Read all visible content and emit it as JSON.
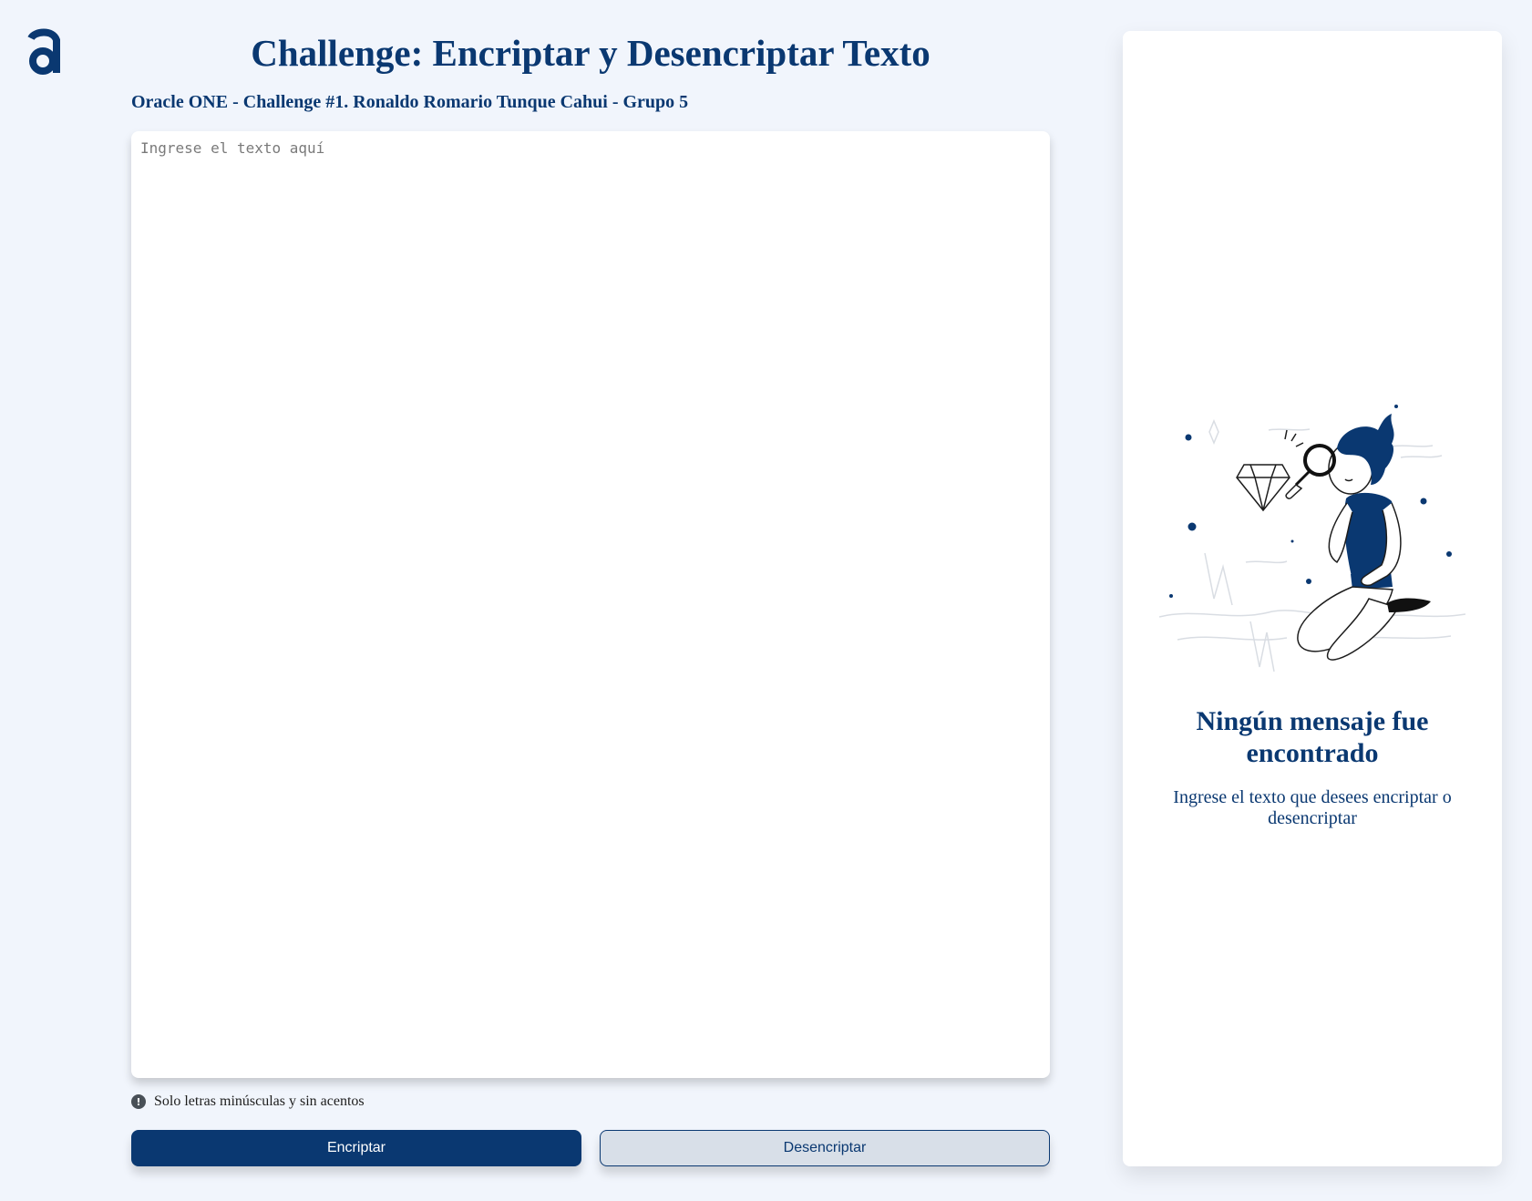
{
  "header": {
    "logo_icon": "alura-logo-icon",
    "title": "Challenge: Encriptar y Desencriptar Texto",
    "subtitle": "Oracle ONE - Challenge #1. Ronaldo Romario Tunque Cahui - Grupo 5"
  },
  "input": {
    "value": "",
    "placeholder": "Ingrese el texto aquí"
  },
  "hint": {
    "icon": "exclamation-circle-icon",
    "text": "Solo letras minúsculas y sin acentos"
  },
  "actions": {
    "encrypt_label": "Encriptar",
    "decrypt_label": "Desencriptar"
  },
  "output": {
    "illustration": "person-with-magnifying-glass-illustration",
    "title": "Ningún mensaje fue encontrado",
    "text": "Ingrese el texto que desees encriptar o desencriptar"
  },
  "colors": {
    "primary": "#0a3871",
    "background": "#f1f5fc",
    "panel": "#ffffff",
    "secondary_button": "#d8dfe8"
  }
}
